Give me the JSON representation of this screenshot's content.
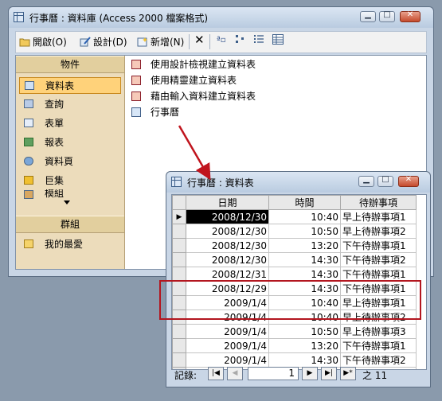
{
  "main_window": {
    "title": "行事曆 : 資料庫 (Access 2000 檔案格式)",
    "toolbar": {
      "open": "開啟(O)",
      "design": "設計(D)",
      "new": "新增(N)"
    },
    "objects_header": "物件",
    "objects": [
      "資料表",
      "查詢",
      "表單",
      "報表",
      "資料頁",
      "巨集",
      "模組"
    ],
    "groups_header": "群組",
    "favorites": "我的最愛",
    "list_items": [
      "使用設計檢視建立資料表",
      "使用精靈建立資料表",
      "藉由輸入資料建立資料表",
      "行事曆"
    ]
  },
  "datasheet": {
    "title": "行事曆 : 資料表",
    "columns": [
      "日期",
      "時間",
      "待辦事項"
    ],
    "rows": [
      [
        "2008/12/30",
        "10:40",
        "早上待辦事項1"
      ],
      [
        "2008/12/30",
        "10:50",
        "早上待辦事項2"
      ],
      [
        "2008/12/30",
        "13:20",
        "下午待辦事項1"
      ],
      [
        "2008/12/30",
        "14:30",
        "下午待辦事項2"
      ],
      [
        "2008/12/31",
        "14:30",
        "下午待辦事項1"
      ],
      [
        "2008/12/29",
        "14:30",
        "下午待辦事項1"
      ],
      [
        "2009/1/4",
        "10:40",
        "早上待辦事項1"
      ],
      [
        "2009/1/4",
        "10:40",
        "早上待辦事項2"
      ],
      [
        "2009/1/4",
        "10:50",
        "早上待辦事項3"
      ],
      [
        "2009/1/4",
        "13:20",
        "下午待辦事項1"
      ],
      [
        "2009/1/4",
        "14:30",
        "下午待辦事項2"
      ]
    ],
    "new_row_marker": "*",
    "nav": {
      "label": "記錄:",
      "current": "1",
      "of_label": "之 11"
    }
  },
  "colors": {
    "highlight_box": "#b3161f",
    "arrow": "#c0141d",
    "selected_object": "#ffd27a"
  }
}
